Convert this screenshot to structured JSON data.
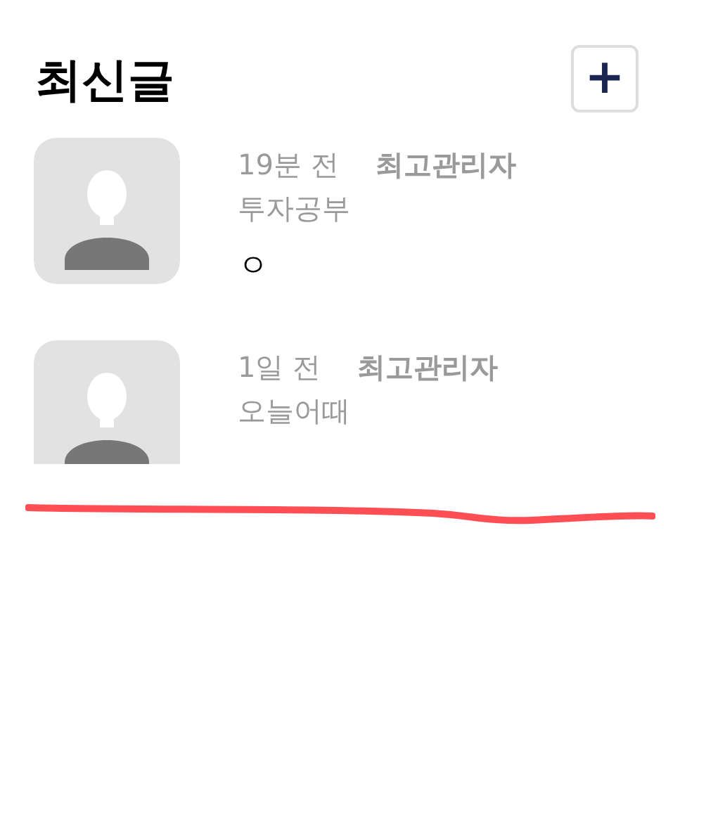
{
  "header": {
    "title": "최신글",
    "add_button": "+"
  },
  "posts": [
    {
      "time": "19분 전",
      "author": "최고관리자",
      "category": "투자공부",
      "body": "ㅇ"
    },
    {
      "time": "1일 전",
      "author": "최고관리자",
      "category": "오늘어때"
    }
  ]
}
